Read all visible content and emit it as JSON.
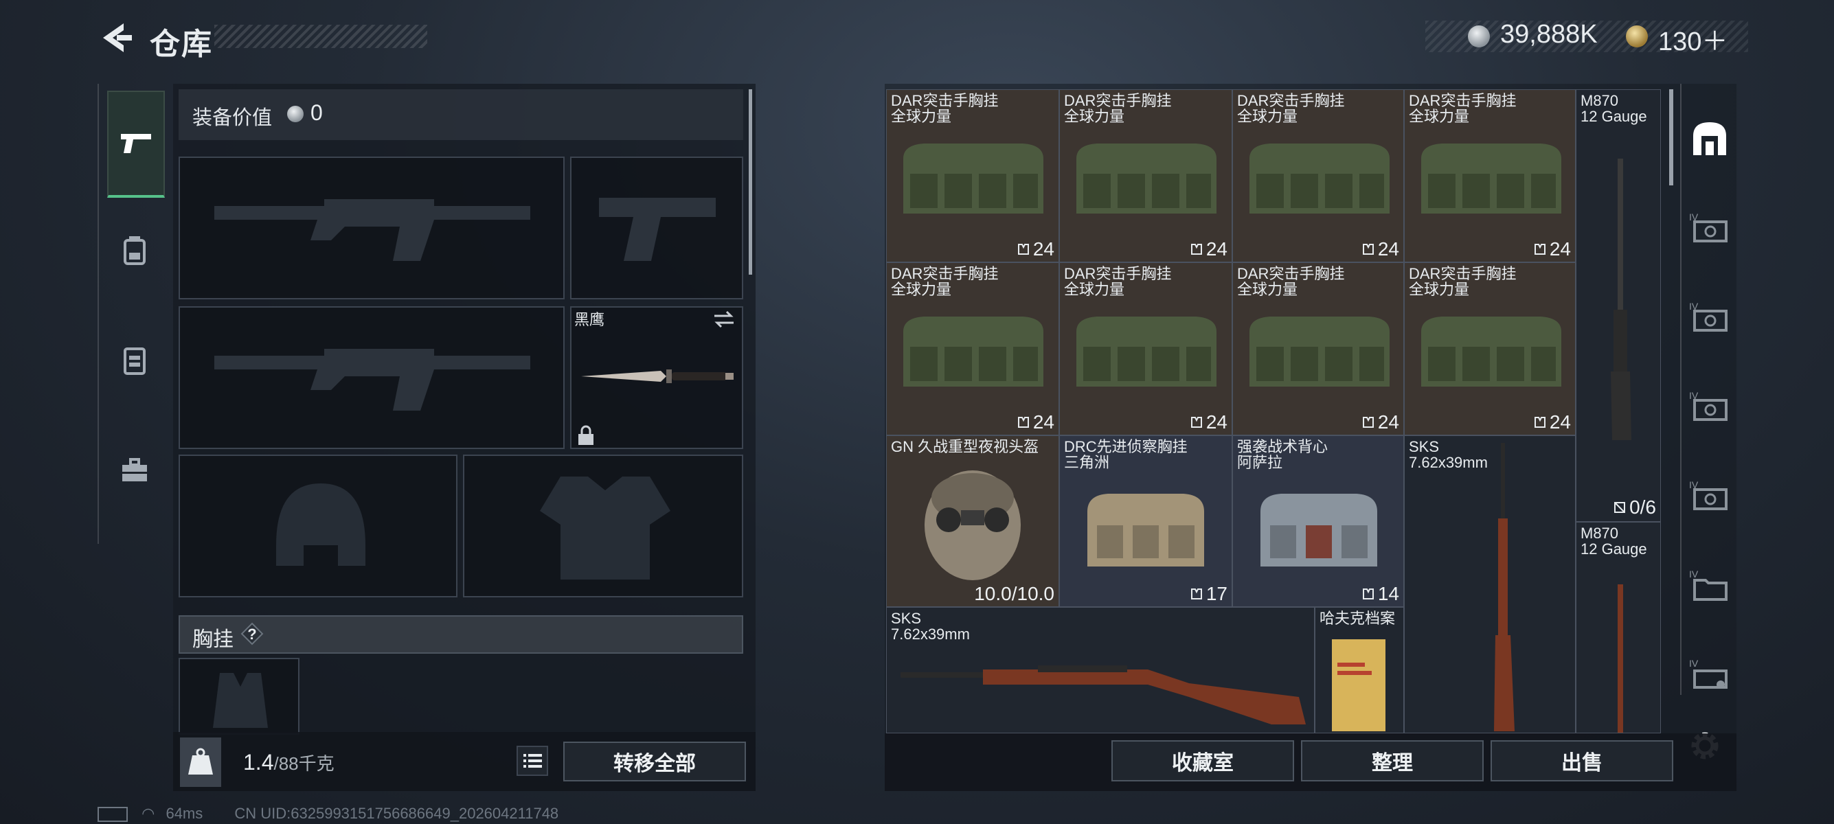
{
  "header": {
    "title": "仓库",
    "currency_silver": "39,888K",
    "currency_gold": "130＋"
  },
  "loadout": {
    "equipment_value_label": "装备价值",
    "equipment_value": "0",
    "knife_name": "黑鹰",
    "chest_rig_label": "胸挂",
    "help_label": "?",
    "weight_current": "1.4",
    "weight_max": "/88千克",
    "transfer_all": "转移全部"
  },
  "warehouse": {
    "items": [
      {
        "name1": "DAR突击手胸挂",
        "name2": "全球力量",
        "count": "24"
      },
      {
        "name1": "DAR突击手胸挂",
        "name2": "全球力量",
        "count": "24"
      },
      {
        "name1": "DAR突击手胸挂",
        "name2": "全球力量",
        "count": "24"
      },
      {
        "name1": "DAR突击手胸挂",
        "name2": "全球力量",
        "count": "24"
      },
      {
        "name1": "DAR突击手胸挂",
        "name2": "全球力量",
        "count": "24"
      },
      {
        "name1": "DAR突击手胸挂",
        "name2": "全球力量",
        "count": "24"
      },
      {
        "name1": "DAR突击手胸挂",
        "name2": "全球力量",
        "count": "24"
      },
      {
        "name1": "DAR突击手胸挂",
        "name2": "全球力量",
        "count": "24"
      },
      {
        "name1": "GN 久战重型夜视头盔",
        "name2": "",
        "count": "10.0/10.0"
      },
      {
        "name1": "DRC先进侦察胸挂",
        "name2": "三角洲",
        "count": "17"
      },
      {
        "name1": "强袭战术背心",
        "name2": "阿萨拉",
        "count": "14"
      },
      {
        "name1": "SKS",
        "name2": "7.62x39mm",
        "count": ""
      },
      {
        "name1": "M870",
        "name2": "12 Gauge",
        "count": "0/6"
      },
      {
        "name1": "M870",
        "name2": "12 Gauge",
        "count": ""
      },
      {
        "name1": "SKS",
        "name2": "7.62x39mm",
        "count": ""
      },
      {
        "name1": "哈夫克档案",
        "name2": "",
        "count": ""
      }
    ],
    "collection_button": "收藏室",
    "sort_button": "整理",
    "sell_button": "出售",
    "side_tab_label": "IV"
  },
  "status": {
    "ping": "64ms",
    "uid": "CN UID:6325993151756686649_202604211748"
  },
  "colors": {
    "accent_green": "#56c28a",
    "item_brown": "#3c3530",
    "item_blue": "#2f3544"
  }
}
